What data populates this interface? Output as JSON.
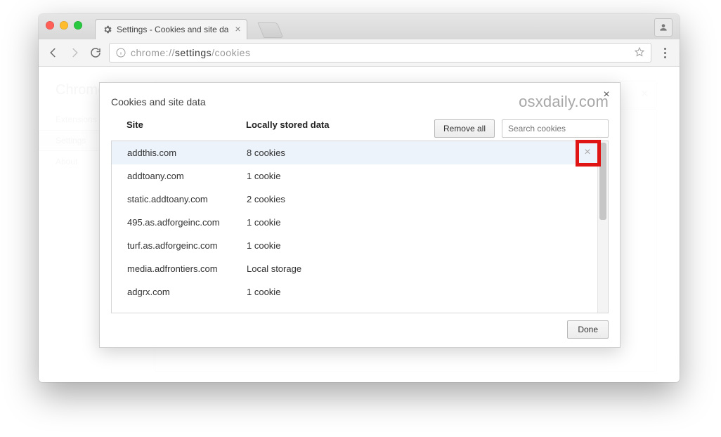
{
  "window": {
    "tab_title": "Settings - Cookies and site da",
    "url_host_dim": "chrome://",
    "url_host_dark": "settings",
    "url_path": "/cookies"
  },
  "sidebar": {
    "brand": "Chrome",
    "items": [
      {
        "label": "Extensions"
      },
      {
        "label": "Settings"
      },
      {
        "label": "About"
      }
    ],
    "selected_index": 1
  },
  "modal": {
    "title": "Cookies and site data",
    "brand": "osxdaily.com",
    "col_site": "Site",
    "col_data": "Locally stored data",
    "remove_all_label": "Remove all",
    "search_placeholder": "Search cookies",
    "done_label": "Done",
    "rows": [
      {
        "site": "addthis.com",
        "data": "8 cookies",
        "selected": true
      },
      {
        "site": "addtoany.com",
        "data": "1 cookie"
      },
      {
        "site": "static.addtoany.com",
        "data": "2 cookies"
      },
      {
        "site": "495.as.adforgeinc.com",
        "data": "1 cookie"
      },
      {
        "site": "turf.as.adforgeinc.com",
        "data": "1 cookie"
      },
      {
        "site": "media.adfrontiers.com",
        "data": "Local storage"
      },
      {
        "site": "adgrx.com",
        "data": "1 cookie"
      }
    ]
  }
}
